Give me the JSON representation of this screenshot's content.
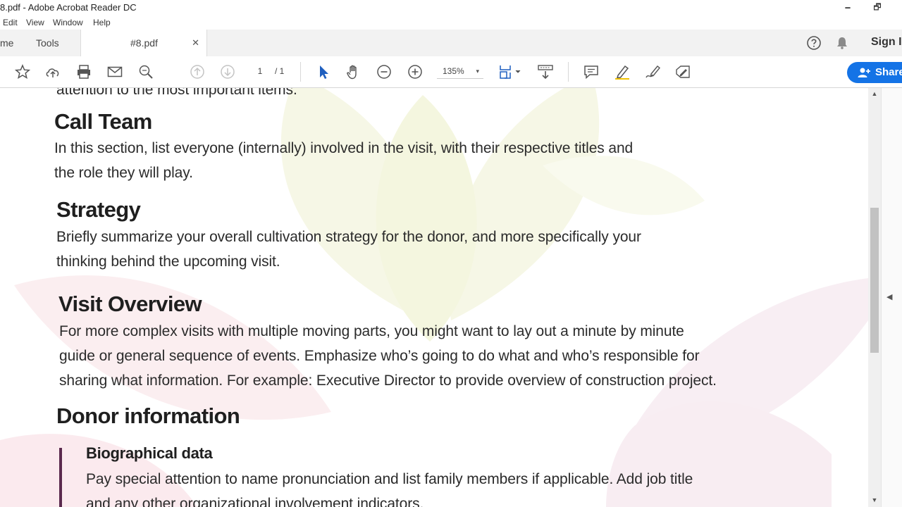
{
  "window": {
    "title": "8.pdf - Adobe Acrobat Reader DC",
    "minimize_glyph": "🗕",
    "restore_glyph": "🗗"
  },
  "menu": {
    "items": [
      "Edit",
      "View",
      "Window",
      "Help"
    ]
  },
  "tabs": {
    "home_label": "me",
    "tools_label": "Tools",
    "document_tab_label": "#8.pdf",
    "close_glyph": "✕",
    "sign_in_label": "Sign I"
  },
  "toolbar": {
    "current_page": "1",
    "page_count": "/ 1",
    "zoom": "135%",
    "zoom_caret": "▾",
    "share_label": "Share",
    "accent_color": "#1473e6",
    "icons": [
      "star-icon",
      "upload-cloud-icon",
      "print-icon",
      "email-icon",
      "search-zoom-icon",
      "page-up-icon",
      "page-down-icon",
      "select-cursor-icon",
      "hand-tool-icon",
      "zoom-out-icon",
      "zoom-in-icon",
      "fit-page-icon",
      "scroll-mode-icon",
      "comment-icon",
      "highlight-pen-icon",
      "draw-icon",
      "fill-sign-icon"
    ]
  },
  "document": {
    "cut_line": "attention to the most important items.",
    "sections": [
      {
        "heading": "Call Team",
        "lines": [
          "In this section, list everyone (internally) involved in the visit, with their respective titles and",
          "the role they will play."
        ]
      },
      {
        "heading": "Strategy",
        "lines": [
          "Briefly summarize your overall cultivation strategy for the donor, and more specifically your",
          "thinking behind the upcoming visit."
        ]
      },
      {
        "heading": "Visit Overview",
        "lines": [
          "For more complex visits with multiple moving parts, you might want to lay out a minute by minute",
          "guide or general sequence of events. Emphasize who’s going to do what and who’s responsible for",
          "sharing what information. For example: Executive Director to provide overview of construction project."
        ]
      },
      {
        "heading": "Donor information",
        "lines": []
      }
    ],
    "subsection": {
      "heading": "Biographical data",
      "lines": [
        "Pay special attention to name pronunciation and list family members if applicable. Add job title",
        "and any other organizational involvement indicators."
      ]
    },
    "callout_color": "#5b2a4e"
  },
  "scrollbar": {
    "up_glyph": "▲",
    "down_glyph": "▼",
    "panel_toggle_glyph": "◀"
  }
}
